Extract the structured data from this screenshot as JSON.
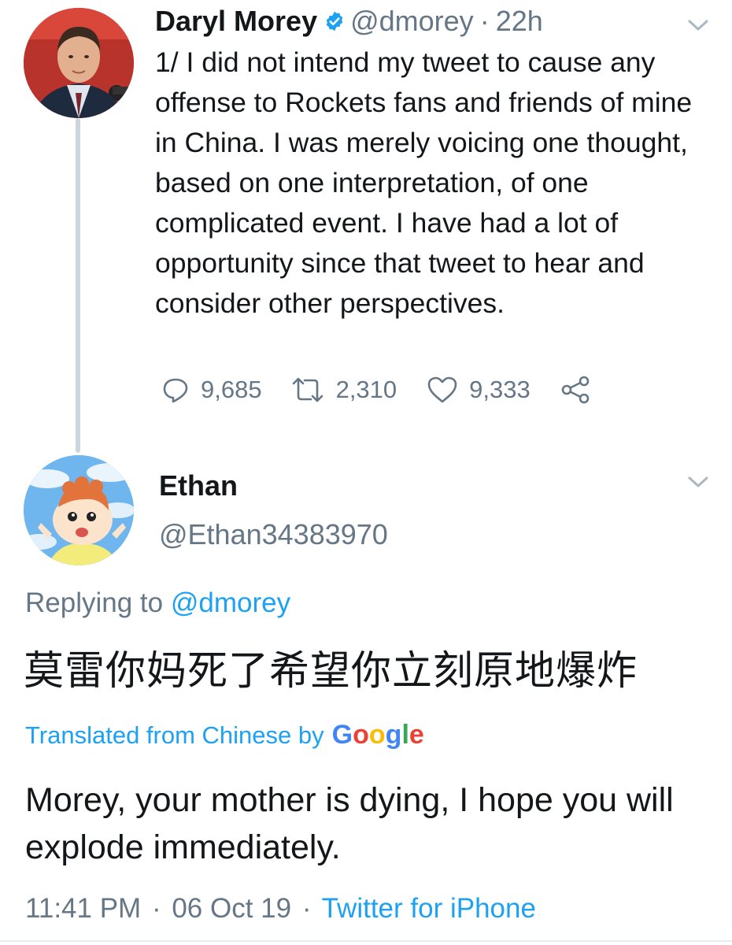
{
  "tweet": {
    "display_name": "Daryl Morey",
    "handle": "@dmorey",
    "separator": "·",
    "time": "22h",
    "text": "1/ I did not intend my tweet to cause any offense to Rockets fans and friends of mine in China. I was merely voicing one thought, based on one interpretation, of one complicated event. I have had a lot of opportunity since that tweet to hear and consider other perspectives.",
    "replies": "9,685",
    "retweets": "2,310",
    "likes": "9,333"
  },
  "reply": {
    "display_name": "Ethan",
    "handle": "@Ethan34383970",
    "replying_prefix": "Replying to",
    "replying_to": "@dmorey",
    "text": "莫雷你妈死了希望你立刻原地爆炸",
    "translated_label": "Translated from Chinese by",
    "translator": "Google",
    "translation": "Morey, your mother is dying, I hope you will explode immediately.",
    "time": "11:41 PM",
    "separator": "·",
    "date": "06 Oct 19",
    "source": "Twitter for iPhone"
  },
  "icons": {
    "verified": "verified-badge-icon",
    "reply": "reply-icon",
    "retweet": "retweet-icon",
    "like": "heart-icon",
    "share": "share-icon",
    "menu": "chevron-down-icon"
  },
  "colors": {
    "link": "#1da1f2",
    "muted": "#657786",
    "text": "#14171a"
  }
}
